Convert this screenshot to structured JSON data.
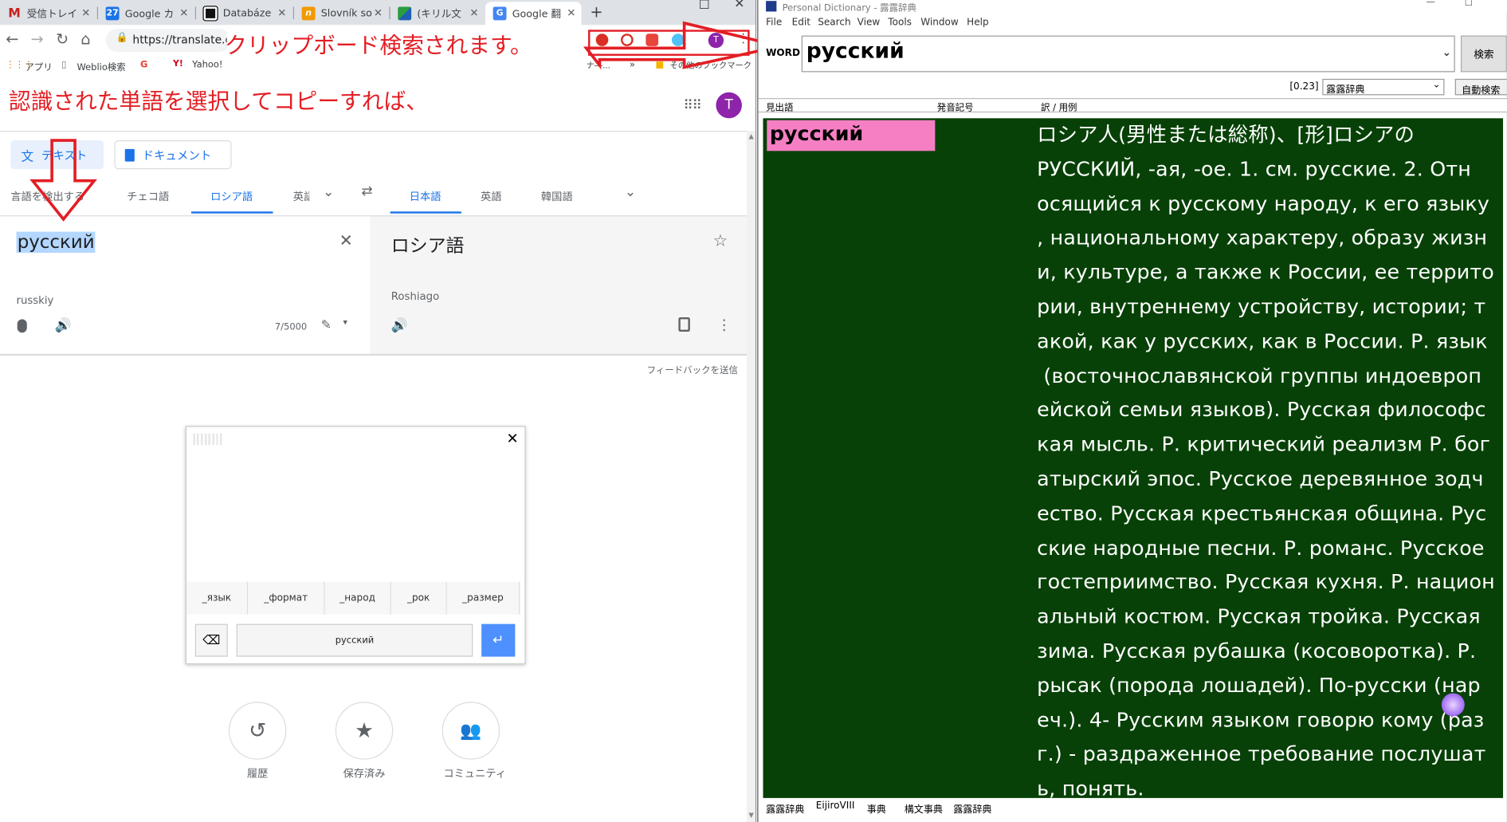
{
  "browser": {
    "tabs": [
      {
        "label": "受信トレイ",
        "icon": "gmail-icon",
        "color": "#c5221f"
      },
      {
        "label": "Google カ",
        "icon": "calendar-icon",
        "color": "#1a73e8",
        "badge": "27"
      },
      {
        "label": "Databáze",
        "icon": "databaze-icon",
        "color": "#111111"
      },
      {
        "label": "Slovník so",
        "icon": "slovnik-icon",
        "color": "#f29900",
        "badge": "n"
      },
      {
        "label": "(キリル文",
        "icon": "kiriru-icon",
        "color": "#2a9d3c"
      },
      {
        "label": "Google 翻",
        "icon": "translate-icon",
        "color": "#4285f4"
      }
    ],
    "url": "https://translate.go",
    "bookmarks": {
      "apps": "アプリ",
      "weblio": "Weblio検索",
      "google": "G",
      "yahoo": "Yahoo!",
      "more": "ナ―...",
      "other": "その他のブックマーク"
    },
    "avatar": "T"
  },
  "translate": {
    "modes": {
      "text": "テキスト",
      "document": "ドキュメント"
    },
    "source_langs": [
      "言語を検出する",
      "チェコ語",
      "ロシア語",
      "英語"
    ],
    "target_langs": [
      "日本語",
      "英語",
      "韓国語"
    ],
    "source_text": "русский",
    "source_translit": "russkiy",
    "char_count": "7/5000",
    "target_text": "ロシア語",
    "target_translit": "Roshiago",
    "feedback": "フィードバックを送信",
    "keyboard": {
      "suggestions": [
        "_язык",
        "_формат",
        "_народ",
        "_рок",
        "_размер"
      ],
      "input": "русский"
    },
    "bottom": {
      "history": "履歴",
      "saved": "保存済み",
      "community": "コミュニティ"
    }
  },
  "annotations": {
    "clipboard": "クリップボード検索されます。",
    "select_copy": "認識された単語を選択してコピーすれば、"
  },
  "dictionary": {
    "title": "Personal Dictionary - 露露辞典",
    "menu": [
      "File",
      "Edit",
      "Search",
      "View",
      "Tools",
      "Window",
      "Help"
    ],
    "word_label": "WORD",
    "word": "русский",
    "search_button": "検索",
    "time": "[0.23]",
    "dict_select": "露露辞典",
    "auto_search": "自動検索",
    "columns": [
      "見出語",
      "発音記号",
      "訳 / 用例"
    ],
    "headword": "русский",
    "definition_lines": [
      "ロシア人(男性または総称)、[形]ロシアの",
      "РУССКИЙ, -ая, -ое. 1. см. русские. 2. Отн",
      "осящийся к русскому народу, к его языку",
      ", национальному характеру, образу жизн",
      "и, культуре, а также к России, ее террито",
      "рии, внутреннему устройству, истории; т",
      "акой, как у русских, как в России. Р. язык",
      " (восточнославянской группы индоевроп",
      "ейской семьи языков). Русская философс",
      "кая мысль. Р. критический реализм Р. бог",
      "атырский эпос. Русское деревянное зодч",
      "ество. Русская крестьянская община. Рус",
      "ские народные песни. Р. романс. Русское",
      "гостеприимство. Русская кухня. Р. национ",
      "альный костюм. Русская тройка. Русская",
      "зима. Русская рубашка (косоворотка). Р.",
      "рысак (порода лошадей). По-русски (нар",
      "еч.). 4- Русским языком говорю кому (раз",
      "г.) - раздраженное требование послушат",
      "ь, понять."
    ],
    "bottom_tabs": [
      "露露辞典",
      "EijiroVIII",
      "事典",
      "構文事典",
      "露露辞典"
    ]
  }
}
